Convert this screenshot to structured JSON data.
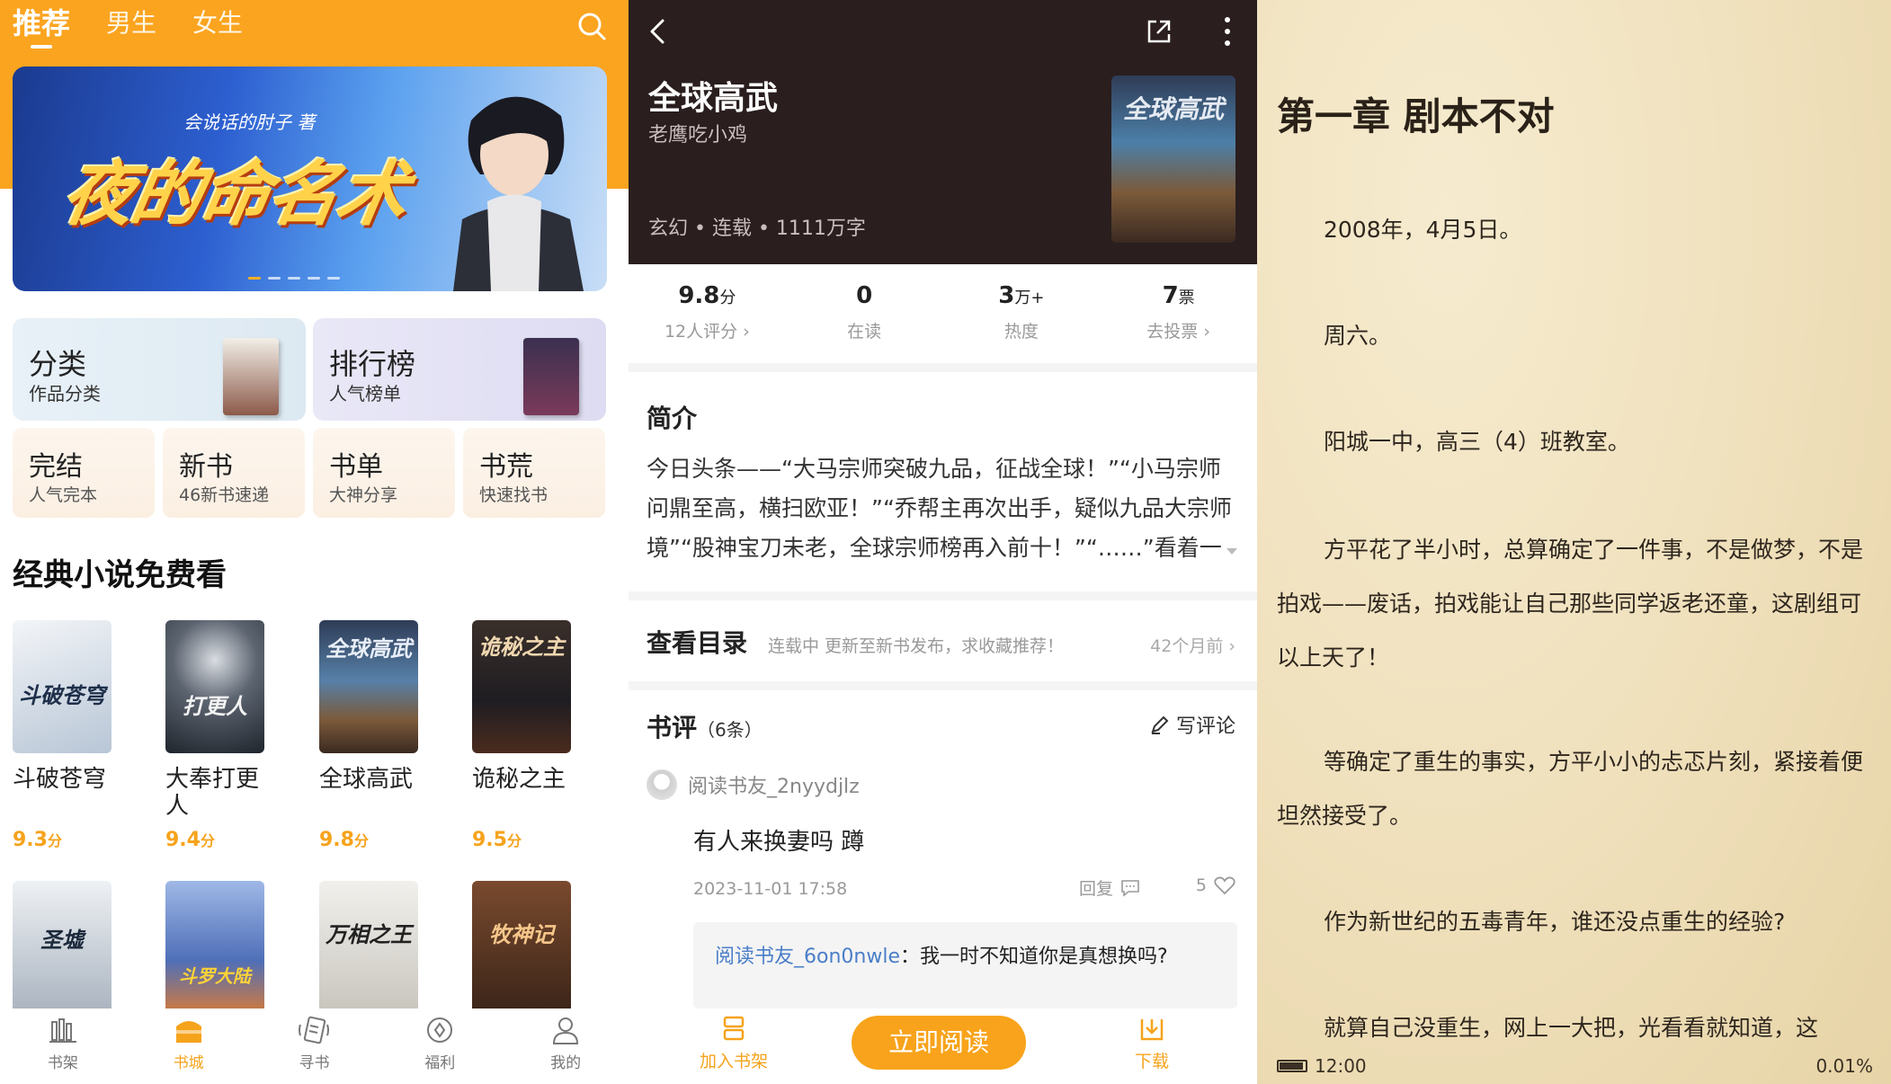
{
  "store": {
    "tabs": [
      "推荐",
      "男生",
      "女生"
    ],
    "banner": {
      "author": "会说话的肘子 著",
      "title": "夜的命名术"
    },
    "categories_big": [
      {
        "title": "分类",
        "sub": "作品分类"
      },
      {
        "title": "排行榜",
        "sub": "人气榜单"
      }
    ],
    "categories_small": [
      {
        "title": "完结",
        "sub": "人气完本"
      },
      {
        "title": "新书",
        "sub": "46新书速递"
      },
      {
        "title": "书单",
        "sub": "大神分享"
      },
      {
        "title": "书荒",
        "sub": "快速找书"
      }
    ],
    "section_title": "经典小说免费看",
    "books": [
      {
        "name": "斗破苍穹",
        "score": "9.3",
        "cover_text": "斗破苍穹",
        "cover_color": "#dfe6ee",
        "text_color": "#1e2f4a"
      },
      {
        "name": "大奉打更人",
        "score": "9.4",
        "cover_text": "打更人",
        "cover_color": "#2c3440",
        "text_color": "#f2f2f2"
      },
      {
        "name": "全球高武",
        "score": "9.8",
        "cover_text": "全球高武",
        "cover_color": "#3a4a66",
        "text_color": "#e8eef8"
      },
      {
        "name": "诡秘之主",
        "score": "9.5",
        "cover_text": "诡秘之主",
        "cover_color": "#2b2b30",
        "text_color": "#f0d7b0"
      }
    ],
    "books_row2": [
      {
        "cover_text": "圣墟",
        "cover_color": "#d8dde3",
        "text_color": "#1c2a3c"
      },
      {
        "cover_text": "斗罗大陆",
        "cover_color": "#6c8fd0",
        "text_color": "#ffd338"
      },
      {
        "cover_text": "万相之王",
        "cover_color": "#e9e7e1",
        "text_color": "#222222"
      },
      {
        "cover_text": "牧神记",
        "cover_color": "#5a3522",
        "text_color": "#f6c68a"
      }
    ],
    "score_unit": "分",
    "nav": [
      "书架",
      "书城",
      "寻书",
      "福利",
      "我的"
    ]
  },
  "detail": {
    "title": "全球高武",
    "author": "老鹰吃小鸡",
    "meta": "玄幻 • 连载 • 1111万字",
    "cover_text": "全球高武",
    "stats": [
      {
        "value": "9.8",
        "unit": "分",
        "label": "12人评分 ›"
      },
      {
        "value": "0",
        "unit": "",
        "label": "在读"
      },
      {
        "value": "3",
        "unit": "万+",
        "label": "热度"
      },
      {
        "value": "7",
        "unit": "票",
        "label": "去投票 ›"
      }
    ],
    "intro_heading": "简介",
    "intro_text": "今日头条——“大马宗师突破九品，征战全球！”“小马宗师问鼎至高，横扫欧亚！”“乔帮主再次出手，疑似九品大宗师境”“股神宝刀未老，全球宗师榜再入前十！”“……”看着一",
    "toc_heading": "查看目录",
    "toc_status": "连载中 更新至新书发布，求收藏推荐！",
    "toc_time": "42个月前 ›",
    "review_heading": "书评",
    "review_count": "（6条）",
    "write_review": "写评论",
    "review": {
      "user": "阅读书友_2nyydjlz",
      "text": "有人来换妻吗 蹲",
      "date": "2023-11-01 17:58",
      "reply": "回复",
      "likes": "5",
      "sub_user": "阅读书友_6on0nwle",
      "sub_text": "：我一时不知道你是真想换吗?"
    },
    "add_shelf": "加入书架",
    "read_now": "立即阅读",
    "download": "下载"
  },
  "reader": {
    "chapter": "第一章 剧本不对",
    "paragraphs": [
      "2008年，4月5日。",
      "周六。",
      "阳城一中，高三（4）班教室。",
      "方平花了半小时，总算确定了一件事，不是做梦，不是拍戏——废话，拍戏能让自己那些同学返老还童，这剧组可以上天了！",
      "等确定了重生的事实，方平小小的忐忑片刻，紧接着便坦然接受了。",
      "作为新世纪的五毒青年，谁还没点重生的经验?",
      "就算自己没重生，网上一大把，光看看就知道，这"
    ],
    "time": "12:00",
    "progress": "0.01%"
  }
}
